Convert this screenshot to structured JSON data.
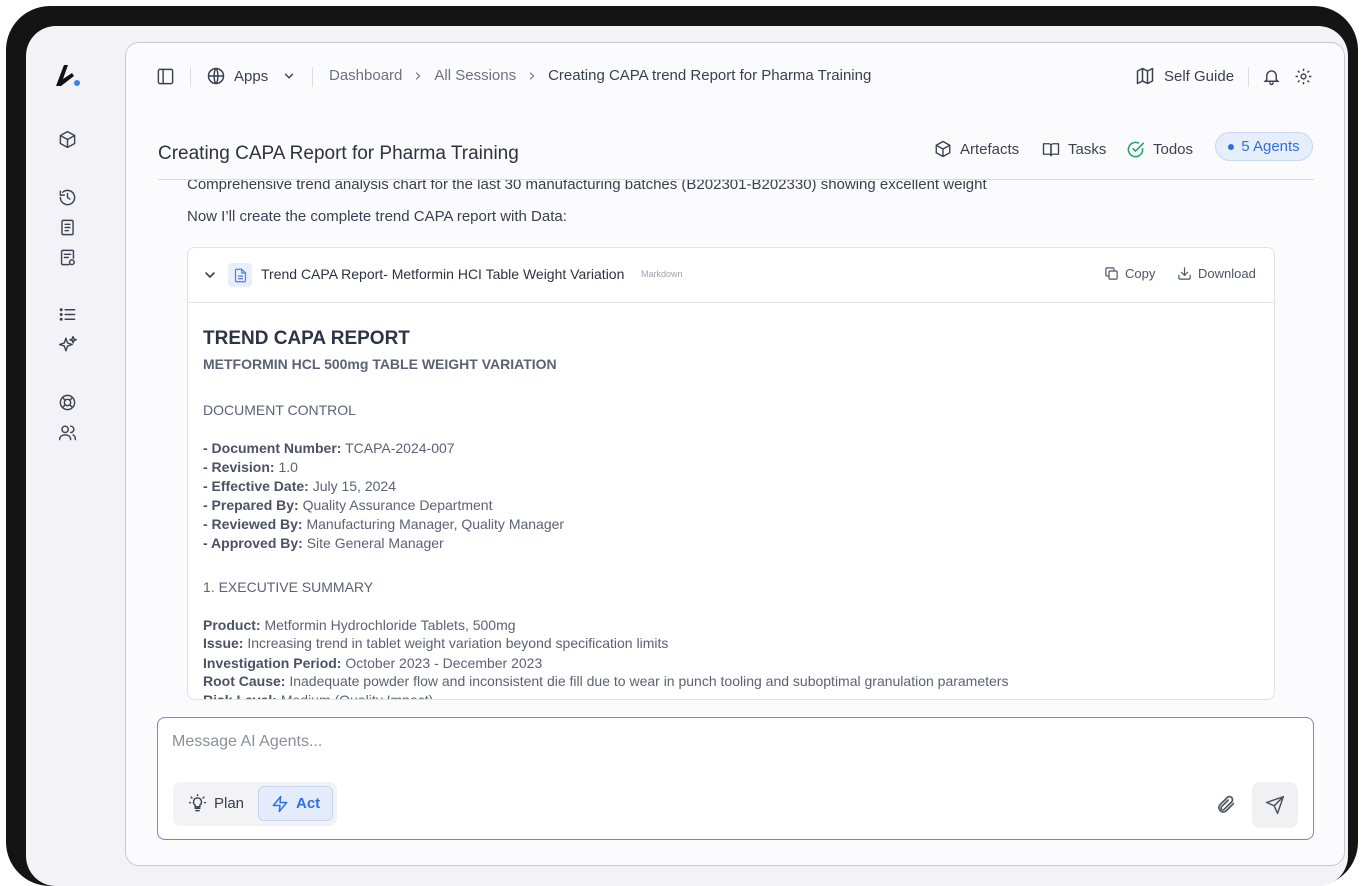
{
  "topbar": {
    "apps_label": "Apps",
    "breadcrumb": [
      "Dashboard",
      "All Sessions",
      "Creating CAPA trend Report for Pharma Training"
    ],
    "self_guide_label": "Self Guide"
  },
  "header": {
    "title": "Creating CAPA  Report for Pharma Training",
    "artefacts_label": "Artefacts",
    "tasks_label": "Tasks",
    "todos_label": "Todos",
    "agents_label": "5 Agents"
  },
  "conversation": {
    "cut_line": "Comprehensive trend analysis chart for the last 30 manufacturing batches (B202301-B202330) showing excellent weight",
    "intro": "Now I’ll create the complete trend CAPA report with Data:"
  },
  "artifact": {
    "title": "Trend CAPA Report- Metformin HCI Table Weight Variation",
    "format_badge": "Markdown",
    "copy_label": "Copy",
    "download_label": "Download",
    "report": {
      "h1": "TREND CAPA REPORT",
      "h2": "METFORMIN HCL 500mg TABLE WEIGHT VARIATION",
      "section_document_control": "DOCUMENT CONTROL",
      "doc_control": [
        {
          "label": "- Document Number:",
          "value": "TCAPA-2024-007"
        },
        {
          "label": "- Revision:",
          "value": "1.0"
        },
        {
          "label": "- Effective Date:",
          "value": "July 15, 2024"
        },
        {
          "label": "- Prepared By:",
          "value": "Quality Assurance Department"
        },
        {
          "label": "- Reviewed By:",
          "value": "Manufacturing Manager, Quality Manager"
        },
        {
          "label": "- Approved By:",
          "value": "Site General Manager"
        }
      ],
      "section_summary": "1. EXECUTIVE SUMMARY",
      "summary": [
        {
          "label": "Product:",
          "value": "Metformin Hydrochloride Tablets, 500mg"
        },
        {
          "label": "Issue:",
          "value": "Increasing trend in tablet weight variation beyond specification limits"
        },
        {
          "label": "Investigation Period:",
          "value": "October 2023 - December 2023"
        },
        {
          "label": "Root Cause:",
          "value": "Inadequate powder flow and inconsistent die fill due to wear in punch tooling and suboptimal granulation parameters"
        },
        {
          "label": "Risk Level:",
          "value": "Medium (Quality Impact)"
        }
      ]
    }
  },
  "composer": {
    "placeholder": "Message AI Agents...",
    "plan_label": "Plan",
    "act_label": "Act"
  },
  "colors": {
    "accent": "#2f6fe4",
    "todos_check": "#22a06b",
    "device_frame": "#141414"
  }
}
